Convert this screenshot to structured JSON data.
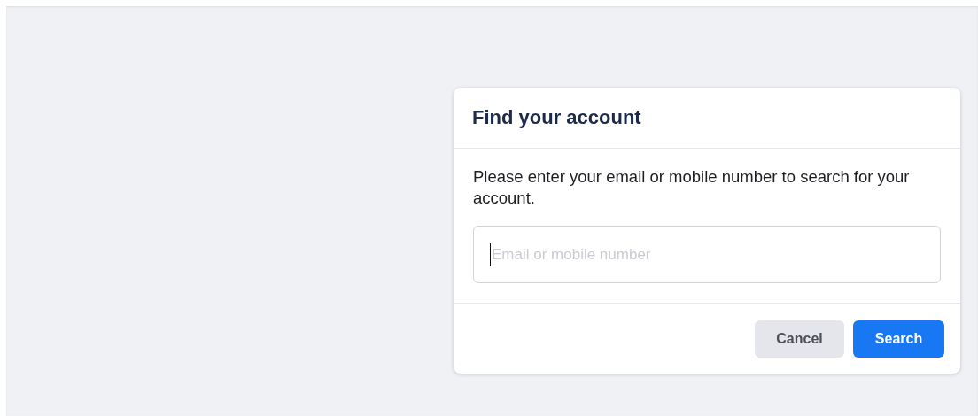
{
  "dialog": {
    "title": "Find your account",
    "message": "Please enter your email or mobile number to search for your account.",
    "field": {
      "placeholder": "Email or mobile number",
      "focused": true
    },
    "buttons": [
      {
        "label": "Cancel",
        "kind": "secondary"
      },
      {
        "label": "Search",
        "kind": "primary"
      }
    ]
  }
}
